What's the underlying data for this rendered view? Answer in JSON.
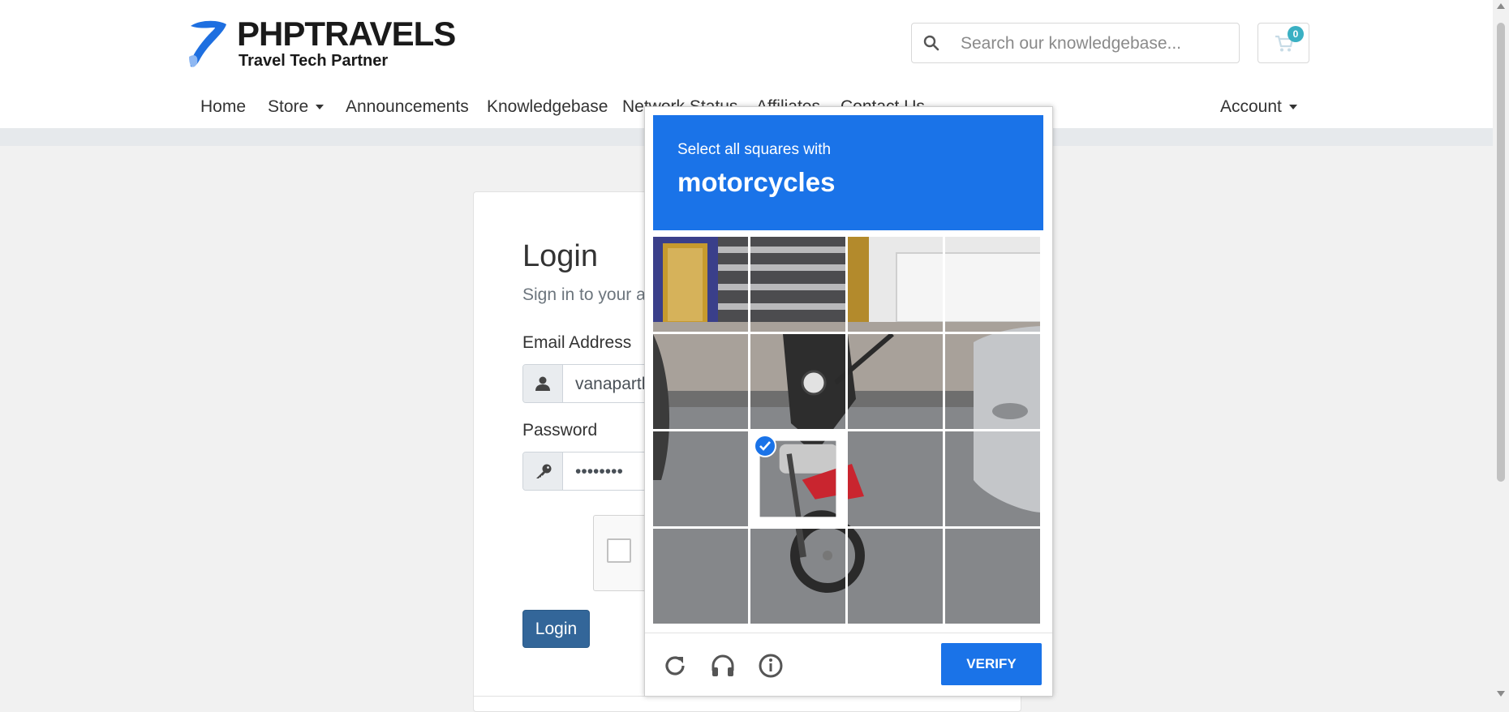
{
  "brand": {
    "name": "PHPTRAVELS",
    "tagline": "Travel Tech Partner"
  },
  "header": {
    "search_placeholder": "Search our knowledgebase...",
    "cart_count": "0"
  },
  "nav": {
    "items": [
      "Home",
      "Store",
      "Announcements",
      "Knowledgebase",
      "Network Status",
      "Affiliates",
      "Contact Us"
    ],
    "account": "Account"
  },
  "login": {
    "title": "Login",
    "subtitle": "Sign in to your account",
    "email_label": "Email Address",
    "email_value": "vanaparthi",
    "password_label": "Password",
    "password_value": "••••••••",
    "login_button": "Login"
  },
  "challenge": {
    "instruction": "Select all squares with",
    "target": "motorcycles",
    "verify_label": "VERIFY",
    "selected_tiles": [
      9
    ],
    "accent_color": "#1a73e8"
  },
  "colors": {
    "accent": "#1a73e8",
    "login_button": "#336699",
    "badge": "#3ab0c3"
  },
  "icons": [
    "search-icon",
    "cart-icon",
    "user-icon",
    "key-icon",
    "reload-icon",
    "headphones-icon",
    "info-icon",
    "check-icon"
  ]
}
